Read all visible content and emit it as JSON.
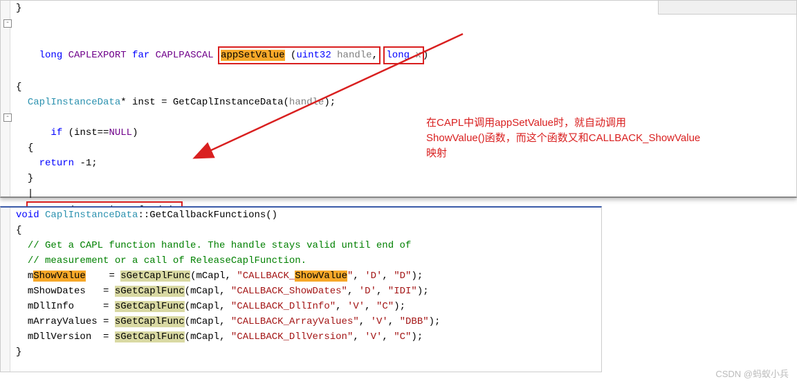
{
  "top": {
    "brace0": "}",
    "line_sig": {
      "kw": "long",
      "macro1": "CAPLEXPORT",
      "kw2": "far",
      "macro2": "CAPLPASCAL",
      "fname": "appSetValue",
      "param1_type": "uint32",
      "param1_name": "handle",
      "param2_type": "long",
      "param2_name": "x"
    },
    "open_brace": "{",
    "decl": {
      "type": "CaplInstanceData",
      "ptr": "*",
      "var": "inst",
      "eq": "=",
      "func": "GetCaplInstanceData",
      "arg": "handle"
    },
    "if_line": {
      "kw": "if",
      "expr_var": "inst",
      "expr_op": "==",
      "expr_null": "NULL"
    },
    "inner_open": "{",
    "return_neg1": {
      "kw": "return",
      "val": "-1"
    },
    "inner_close": "}",
    "cursor": "|",
    "return_show": {
      "kw": "return",
      "var": "inst",
      "arrow": "->",
      "func": "ShowValue",
      "arg": "x"
    },
    "close_brace": "}"
  },
  "bottom": {
    "sig": {
      "kw": "void",
      "cls": "CaplInstanceData",
      "scope": "::",
      "fname": "GetCallbackFunctions"
    },
    "open_brace": "{",
    "comment1": "// Get a CAPL function handle. The handle stays valid until end of",
    "comment2": "// measurement or a call of ReleaseCaplFunction.",
    "rows": [
      {
        "var_pre": "m",
        "var_hl": "ShowValue",
        "var_post": "",
        "func": "sGetCaplFunc",
        "arg1": "mCapl",
        "cb_pre": "CALLBACK_",
        "cb_hl": "ShowValue",
        "cb_post": "",
        "c1": "'D'",
        "c2": "\"D\""
      },
      {
        "var_pre": "mShowDates",
        "var_hl": "",
        "var_post": "",
        "func": "sGetCaplFunc",
        "arg1": "mCapl",
        "cb_pre": "CALLBACK_ShowDates",
        "cb_hl": "",
        "cb_post": "",
        "c1": "'D'",
        "c2": "\"IDI\""
      },
      {
        "var_pre": "mDllInfo",
        "var_hl": "",
        "var_post": "",
        "func": "sGetCaplFunc",
        "arg1": "mCapl",
        "cb_pre": "CALLBACK_DllInfo",
        "cb_hl": "",
        "cb_post": "",
        "c1": "'V'",
        "c2": "\"C\""
      },
      {
        "var_pre": "mArrayValues",
        "var_hl": "",
        "var_post": "",
        "func": "sGetCaplFunc",
        "arg1": "mCapl",
        "cb_pre": "CALLBACK_ArrayValues",
        "cb_hl": "",
        "cb_post": "",
        "c1": "'V'",
        "c2": "\"DBB\""
      },
      {
        "var_pre": "mDllVersion",
        "var_hl": "",
        "var_post": "",
        "func": "sGetCaplFunc",
        "arg1": "mCapl",
        "cb_pre": "CALLBACK_DllVersion",
        "cb_hl": "",
        "cb_post": "",
        "c1": "'V'",
        "c2": "\"C\""
      }
    ],
    "close_brace": "}"
  },
  "annotation": {
    "l1": "在CAPL中调用appSetValue时，就自动调用",
    "l2": "ShowValue()函数，而这个函数又和CALLBACK_ShowValue",
    "l3": "映射"
  },
  "watermark": "CSDN @蚂蚁小兵"
}
